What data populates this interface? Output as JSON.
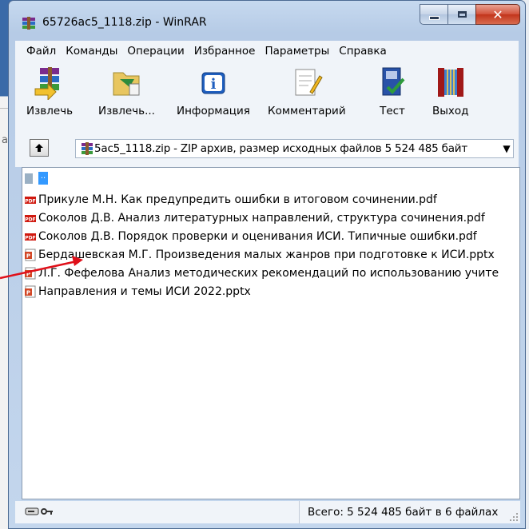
{
  "window": {
    "title": "65726ac5_1118.zip - WinRAR"
  },
  "menu": [
    "Файл",
    "Команды",
    "Операции",
    "Избранное",
    "Параметры",
    "Справка"
  ],
  "toolbar": [
    {
      "label": "Извлечь",
      "icon": "extract-to-icon"
    },
    {
      "label": "Извлечь...",
      "icon": "extract-icon"
    },
    {
      "label": "Информация",
      "icon": "info-icon"
    },
    {
      "label": "Комментарий",
      "icon": "comment-icon"
    },
    {
      "label": "Тест",
      "icon": "test-icon"
    },
    {
      "label": "Выход",
      "icon": "exit-icon"
    }
  ],
  "address": {
    "text": "5ac5_1118.zip - ZIP архив, размер исходных файлов 5 524 485 байт"
  },
  "files": [
    {
      "name": "..",
      "type": "updir"
    },
    {
      "name": "Прикуле М.Н. Как предупредить ошибки в итоговом сочинении.pdf",
      "type": "pdf"
    },
    {
      "name": "Соколов Д.В. Анализ литературных направлений, структура сочинения.pdf",
      "type": "pdf"
    },
    {
      "name": "Соколов Д.В. Порядок проверки и оценивания ИСИ. Типичные ошибки.pdf",
      "type": "pdf"
    },
    {
      "name": "Бердашевская М.Г. Произведения малых жанров при подготовке к ИСИ.pptx",
      "type": "pptx"
    },
    {
      "name": "Л.Г. Фефелова Анализ методических рекомендаций по использованию учите",
      "type": "pptx"
    },
    {
      "name": "Направления и темы ИСИ 2022.pptx",
      "type": "pptx"
    }
  ],
  "status": {
    "text": "Всего: 5 524 485 байт в 6 файлах"
  },
  "colors": {
    "selection": "#3399ff",
    "arrow": "#e0101a",
    "close": "#c2341b"
  }
}
